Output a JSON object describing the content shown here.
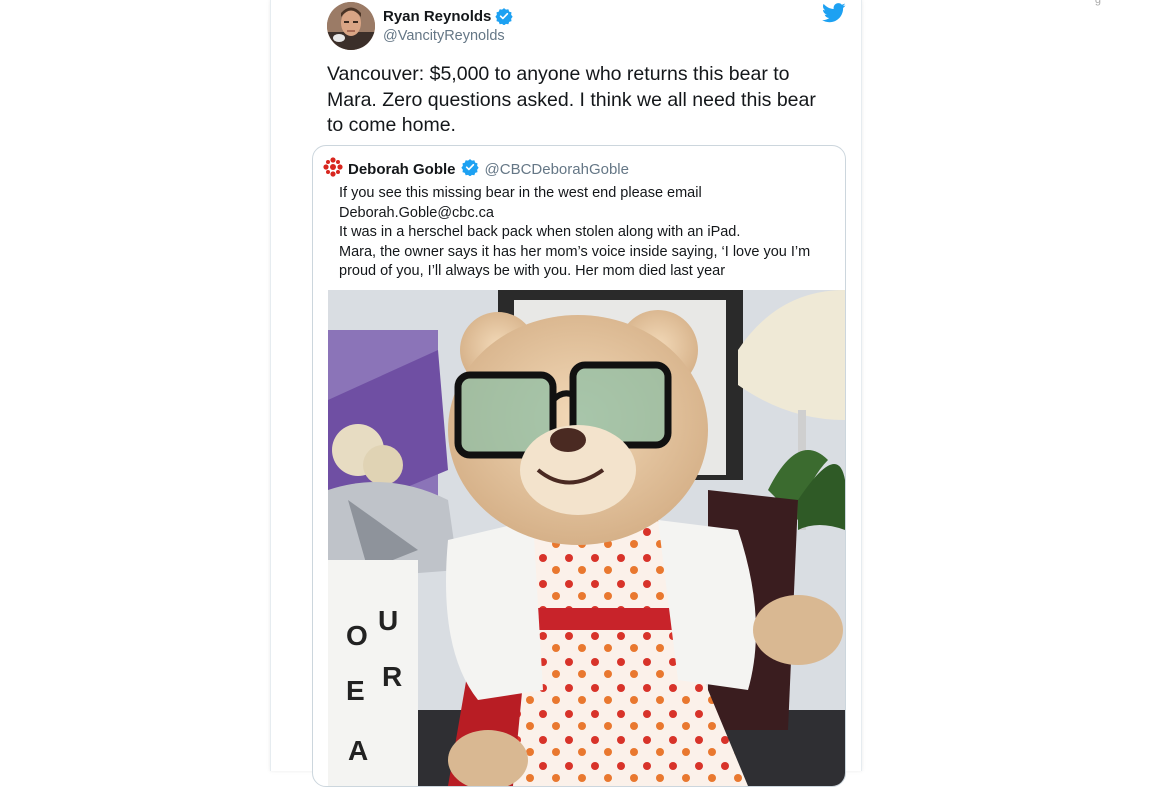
{
  "tweet": {
    "author_name": "Ryan Reynolds",
    "author_handle": "@VancityReynolds",
    "text": "Vancouver: $5,000 to anyone who returns this bear to Mara. Zero questions asked. I think we all need this bear to come home.",
    "icons": {
      "verified": "verified-badge-icon",
      "platform": "twitter-bird-icon"
    },
    "colors": {
      "accent": "#1da1f2",
      "text": "#14171a",
      "muted": "#657786",
      "border": "#ccd6dd"
    }
  },
  "quoted": {
    "author_name": "Deborah Goble",
    "author_handle": "@CBCDeborahGoble",
    "lines": [
      "If you see this missing bear in the west end please email",
      "Deborah.Goble@cbc.ca",
      "It was in a herschel back pack when stolen along with an iPad.",
      "Mara, the owner says it has her mom’s voice inside saying, ‘I love you I’m",
      "proud of you, I’ll always be with you. Her mom died last year"
    ],
    "icons": {
      "avatar": "cbc-logo-icon",
      "verified": "verified-badge-icon"
    },
    "image": {
      "description_icon": "teddy-bear-photo"
    },
    "lightbox_letters": [
      "O",
      "U",
      "E",
      "R",
      "A"
    ]
  },
  "corner_glyph": "g"
}
